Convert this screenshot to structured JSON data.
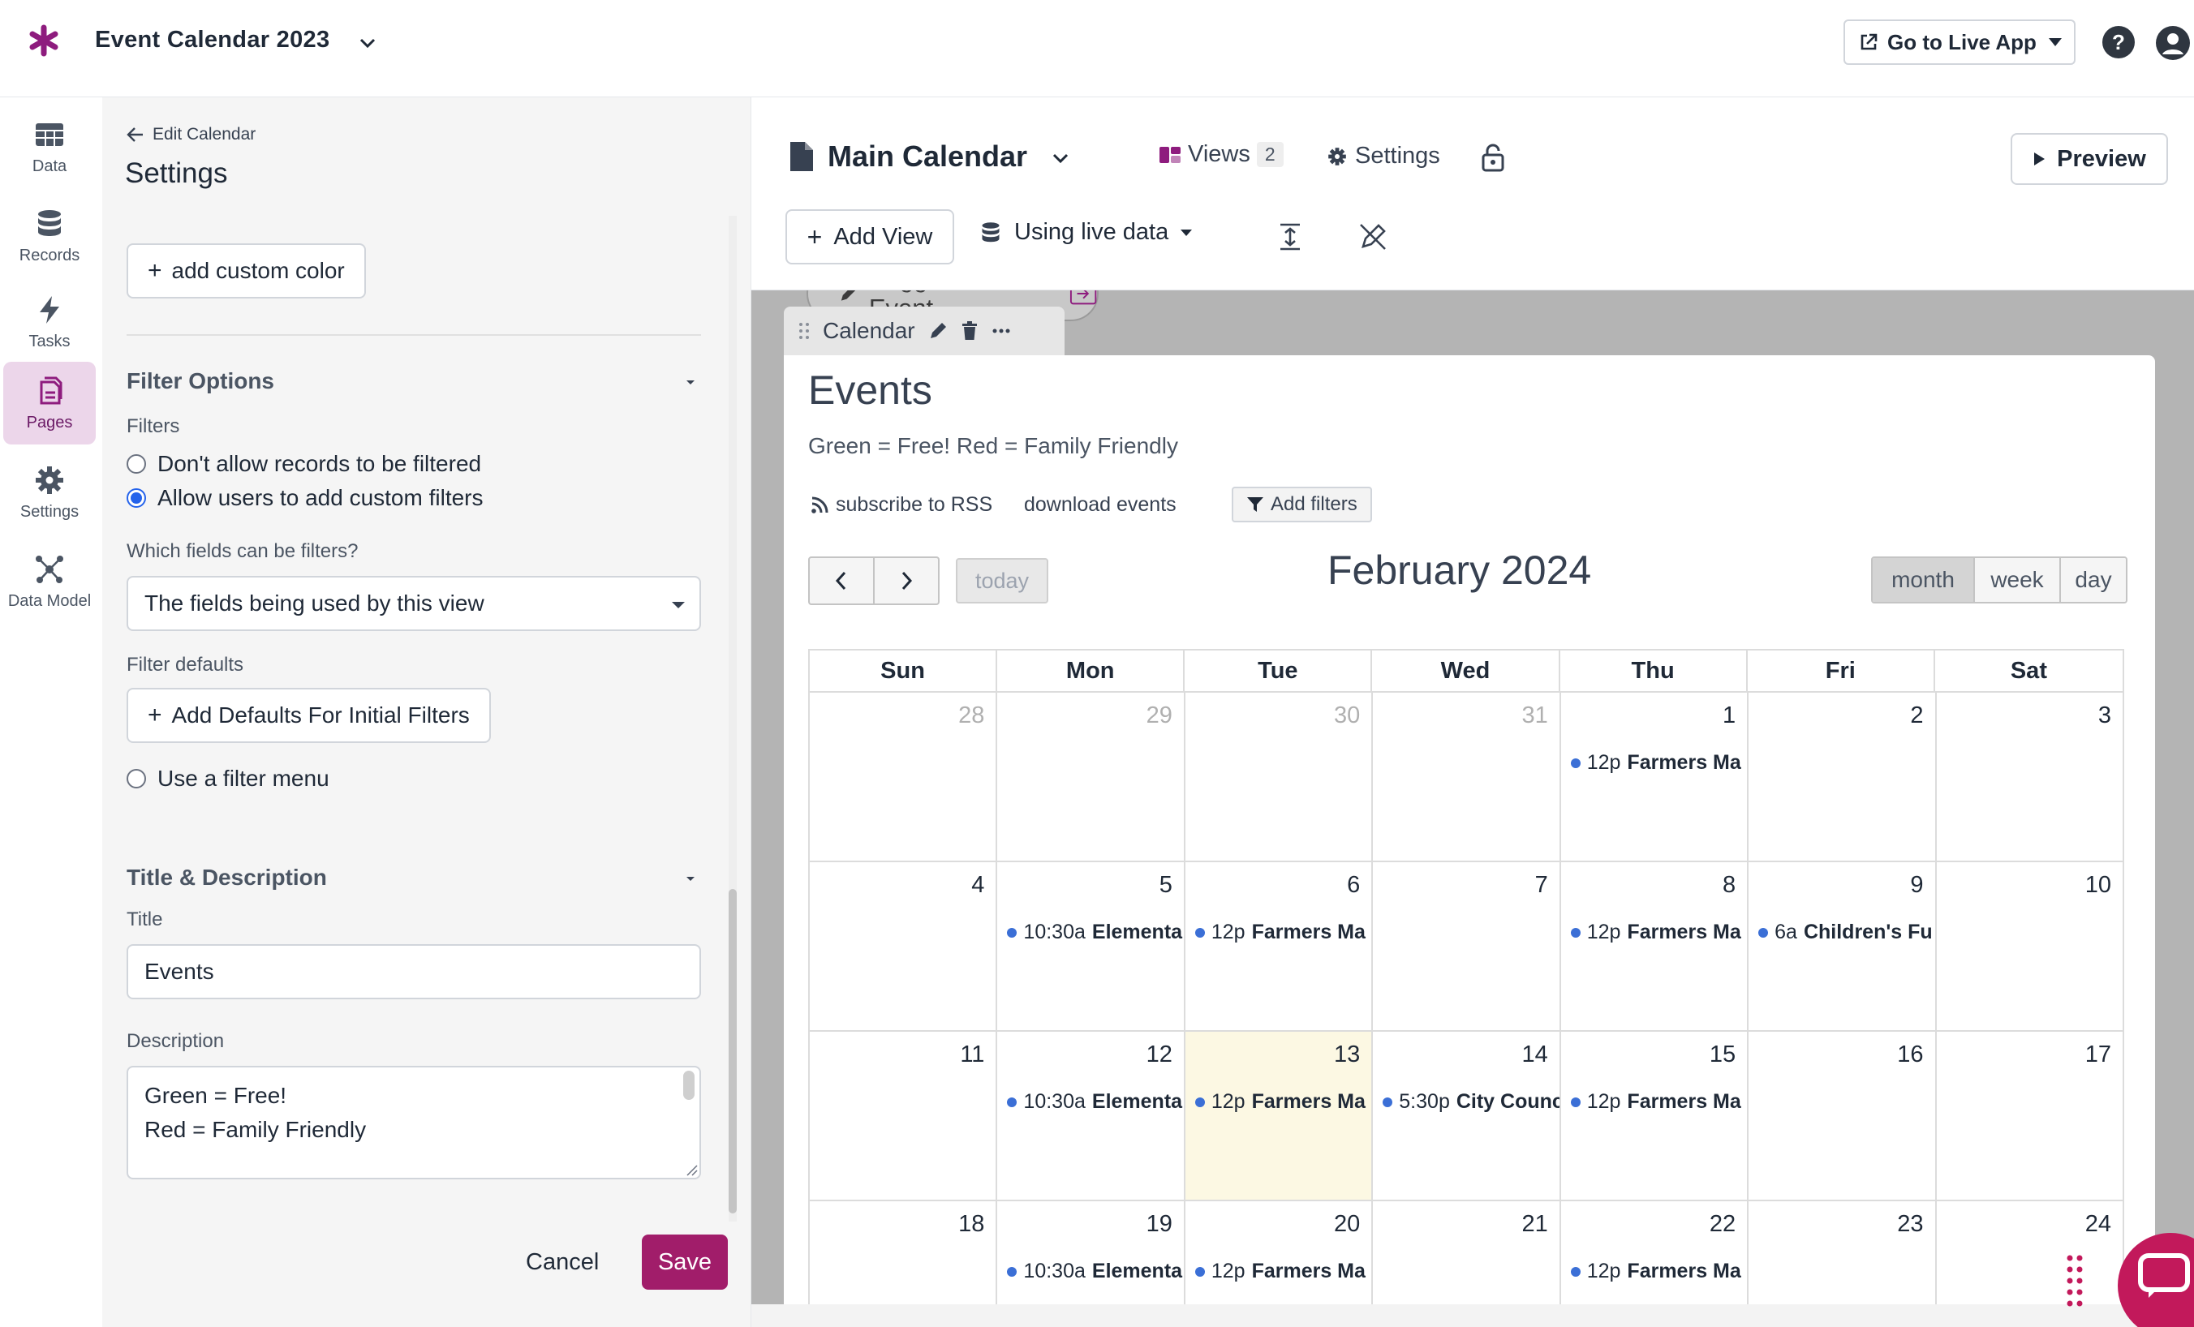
{
  "app": {
    "title": "Event Calendar 2023",
    "live_app_label": "Go to Live App",
    "brand_color": "#8e1c7e"
  },
  "leftnav": {
    "items": [
      {
        "label": "Data",
        "icon": "table-icon"
      },
      {
        "label": "Records",
        "icon": "database-icon"
      },
      {
        "label": "Tasks",
        "icon": "bolt-icon"
      },
      {
        "label": "Pages",
        "icon": "pages-icon",
        "active": true
      },
      {
        "label": "Settings",
        "icon": "gear-icon"
      },
      {
        "label": "Data Model",
        "icon": "data-model-icon"
      }
    ]
  },
  "panel": {
    "back_label": "Edit Calendar",
    "title": "Settings",
    "add_color_label": "add custom color",
    "filter_section": {
      "title": "Filter Options",
      "filters_label": "Filters",
      "option_no_filter": "Don't allow records to be filtered",
      "option_custom": "Allow users to add custom filters",
      "fields_label": "Which fields can be filters?",
      "fields_value": "The fields being used by this view",
      "defaults_label": "Filter defaults",
      "defaults_button": "Add Defaults For Initial Filters",
      "option_menu": "Use a filter menu"
    },
    "title_section": {
      "title": "Title & Description",
      "title_label": "Title",
      "title_value": "Events",
      "description_label": "Description",
      "description_line1": "Green = Free!",
      "description_line2": "Red = Family Friendly"
    },
    "cancel_label": "Cancel",
    "save_label": "Save",
    "save_color": "#a11d6a"
  },
  "main": {
    "page_name": "Main Calendar",
    "views_label": "Views",
    "views_count": "2",
    "settings_label": "Settings",
    "preview_label": "Preview",
    "add_view_label": "Add View",
    "data_source_label": "Using live data",
    "suggest_label": "Suggest an Event",
    "view_tab_label": "Calendar"
  },
  "calendar": {
    "title": "Events",
    "description": "Green = Free! Red = Family Friendly",
    "rss_label": "subscribe to RSS",
    "download_label": "download events",
    "filters_label": "Add filters",
    "today_label": "today",
    "month_title": "February 2024",
    "modes": [
      "month",
      "week",
      "day"
    ],
    "active_mode": "month",
    "weekdays": [
      "Sun",
      "Mon",
      "Tue",
      "Wed",
      "Thu",
      "Fri",
      "Sat"
    ],
    "event_dot_color": "#3b6fd6",
    "today_color": "#fcf8e3",
    "weeks": [
      [
        {
          "day": "28",
          "other": true
        },
        {
          "day": "29",
          "other": true
        },
        {
          "day": "30",
          "other": true
        },
        {
          "day": "31",
          "other": true
        },
        {
          "day": "1",
          "event": {
            "time": "12p",
            "name": "Farmers Ma"
          }
        },
        {
          "day": "2"
        },
        {
          "day": "3"
        }
      ],
      [
        {
          "day": "4"
        },
        {
          "day": "5",
          "event": {
            "time": "10:30a",
            "name": "Elementa"
          }
        },
        {
          "day": "6",
          "event": {
            "time": "12p",
            "name": "Farmers Ma"
          }
        },
        {
          "day": "7"
        },
        {
          "day": "8",
          "event": {
            "time": "12p",
            "name": "Farmers Ma"
          }
        },
        {
          "day": "9",
          "event": {
            "time": "6a",
            "name": "Children's Fu"
          }
        },
        {
          "day": "10"
        }
      ],
      [
        {
          "day": "11"
        },
        {
          "day": "12",
          "event": {
            "time": "10:30a",
            "name": "Elementa"
          }
        },
        {
          "day": "13",
          "today": true,
          "event": {
            "time": "12p",
            "name": "Farmers Ma"
          }
        },
        {
          "day": "14",
          "event": {
            "time": "5:30p",
            "name": "City Counc"
          }
        },
        {
          "day": "15",
          "event": {
            "time": "12p",
            "name": "Farmers Ma"
          }
        },
        {
          "day": "16"
        },
        {
          "day": "17"
        }
      ],
      [
        {
          "day": "18"
        },
        {
          "day": "19",
          "event": {
            "time": "10:30a",
            "name": "Elementa"
          }
        },
        {
          "day": "20",
          "event": {
            "time": "12p",
            "name": "Farmers Ma"
          }
        },
        {
          "day": "21"
        },
        {
          "day": "22",
          "event": {
            "time": "12p",
            "name": "Farmers Ma"
          }
        },
        {
          "day": "23"
        },
        {
          "day": "24"
        }
      ]
    ]
  }
}
